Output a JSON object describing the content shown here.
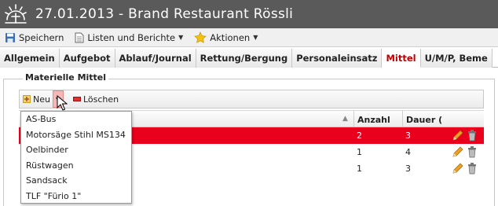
{
  "window": {
    "title": "27.01.2013 - Brand Restaurant Rössli",
    "logo_icon": "sunburst-logo-icon"
  },
  "toolbar": {
    "items": [
      {
        "label": "Speichern",
        "icon": "save-icon"
      },
      {
        "label": "Listen und Berichte",
        "icon": "document-icon",
        "has_dropdown": true
      },
      {
        "label": "Aktionen",
        "icon": "star-icon",
        "has_dropdown": true
      }
    ]
  },
  "tabs": [
    {
      "label": "Allgemein",
      "active": false
    },
    {
      "label": "Aufgebot",
      "active": false
    },
    {
      "label": "Ablauf/Journal",
      "active": false
    },
    {
      "label": "Rettung/Bergung",
      "active": false
    },
    {
      "label": "Personaleinsatz",
      "active": false
    },
    {
      "label": "Mittel",
      "active": true
    },
    {
      "label": "U/M/P, Beme",
      "active": false
    }
  ],
  "section": {
    "legend": "Materielle Mittel"
  },
  "grid_toolbar": {
    "new_label": "Neu",
    "delete_label": "Löschen"
  },
  "grid": {
    "columns": [
      "Anzahl",
      "Dauer ("
    ],
    "rows": [
      {
        "anzahl": "2",
        "dauer": "3",
        "selected": true
      },
      {
        "anzahl": "1",
        "dauer": "4",
        "selected": false
      },
      {
        "anzahl": "1",
        "dauer": "3",
        "selected": false
      }
    ]
  },
  "dropdown": {
    "items": [
      "AS-Bus",
      "Motorsäge Stihl MS134",
      "Oelbinder",
      "Rüstwagen",
      "Sandsack",
      "TLF \"Fürio 1\""
    ]
  },
  "colors": {
    "titlebar": "#5a5a5a",
    "active_tab_text": "#c00000",
    "selected_row": "#e8001c",
    "split_button": "#f4b8b8"
  }
}
